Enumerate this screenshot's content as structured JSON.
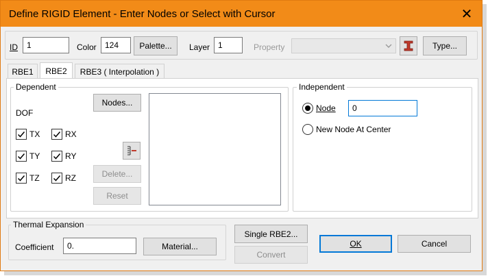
{
  "window": {
    "title": "Define RIGID Element - Enter Nodes or Select with Cursor",
    "close_glyph": "✕"
  },
  "header": {
    "id_label": "ID",
    "id_value": "1",
    "color_label": "Color",
    "color_value": "124",
    "palette_button": "Palette...",
    "layer_label": "Layer",
    "layer_value": "1",
    "property_label": "Property",
    "property_value": "",
    "type_button": "Type..."
  },
  "tabs": [
    {
      "label": "RBE1",
      "active": false
    },
    {
      "label": "RBE2",
      "active": true
    },
    {
      "label": "RBE3 ( Interpolation )",
      "active": false
    }
  ],
  "dependent": {
    "title": "Dependent",
    "dof_label": "DOF",
    "nodes_button": "Nodes...",
    "delete_button": "Delete...",
    "reset_button": "Reset",
    "dofs": [
      {
        "label": "TX",
        "checked": true
      },
      {
        "label": "RX",
        "checked": true
      },
      {
        "label": "TY",
        "checked": true
      },
      {
        "label": "RY",
        "checked": true
      },
      {
        "label": "TZ",
        "checked": true
      },
      {
        "label": "RZ",
        "checked": true
      }
    ]
  },
  "independent": {
    "title": "Independent",
    "node_label": "Node",
    "node_value": "0",
    "new_node_label": "New Node At Center",
    "selected": "node"
  },
  "thermal": {
    "title": "Thermal Expansion",
    "coefficient_label": "Coefficient",
    "coefficient_value": "0.",
    "material_button": "Material..."
  },
  "footer": {
    "single_rbe2_button": "Single RBE2...",
    "convert_button": "Convert",
    "ok_button": "OK",
    "cancel_button": "Cancel"
  },
  "colors": {
    "titlebar": "#f28b18",
    "accent": "#0078d7",
    "property_icon": "#c0392b"
  }
}
